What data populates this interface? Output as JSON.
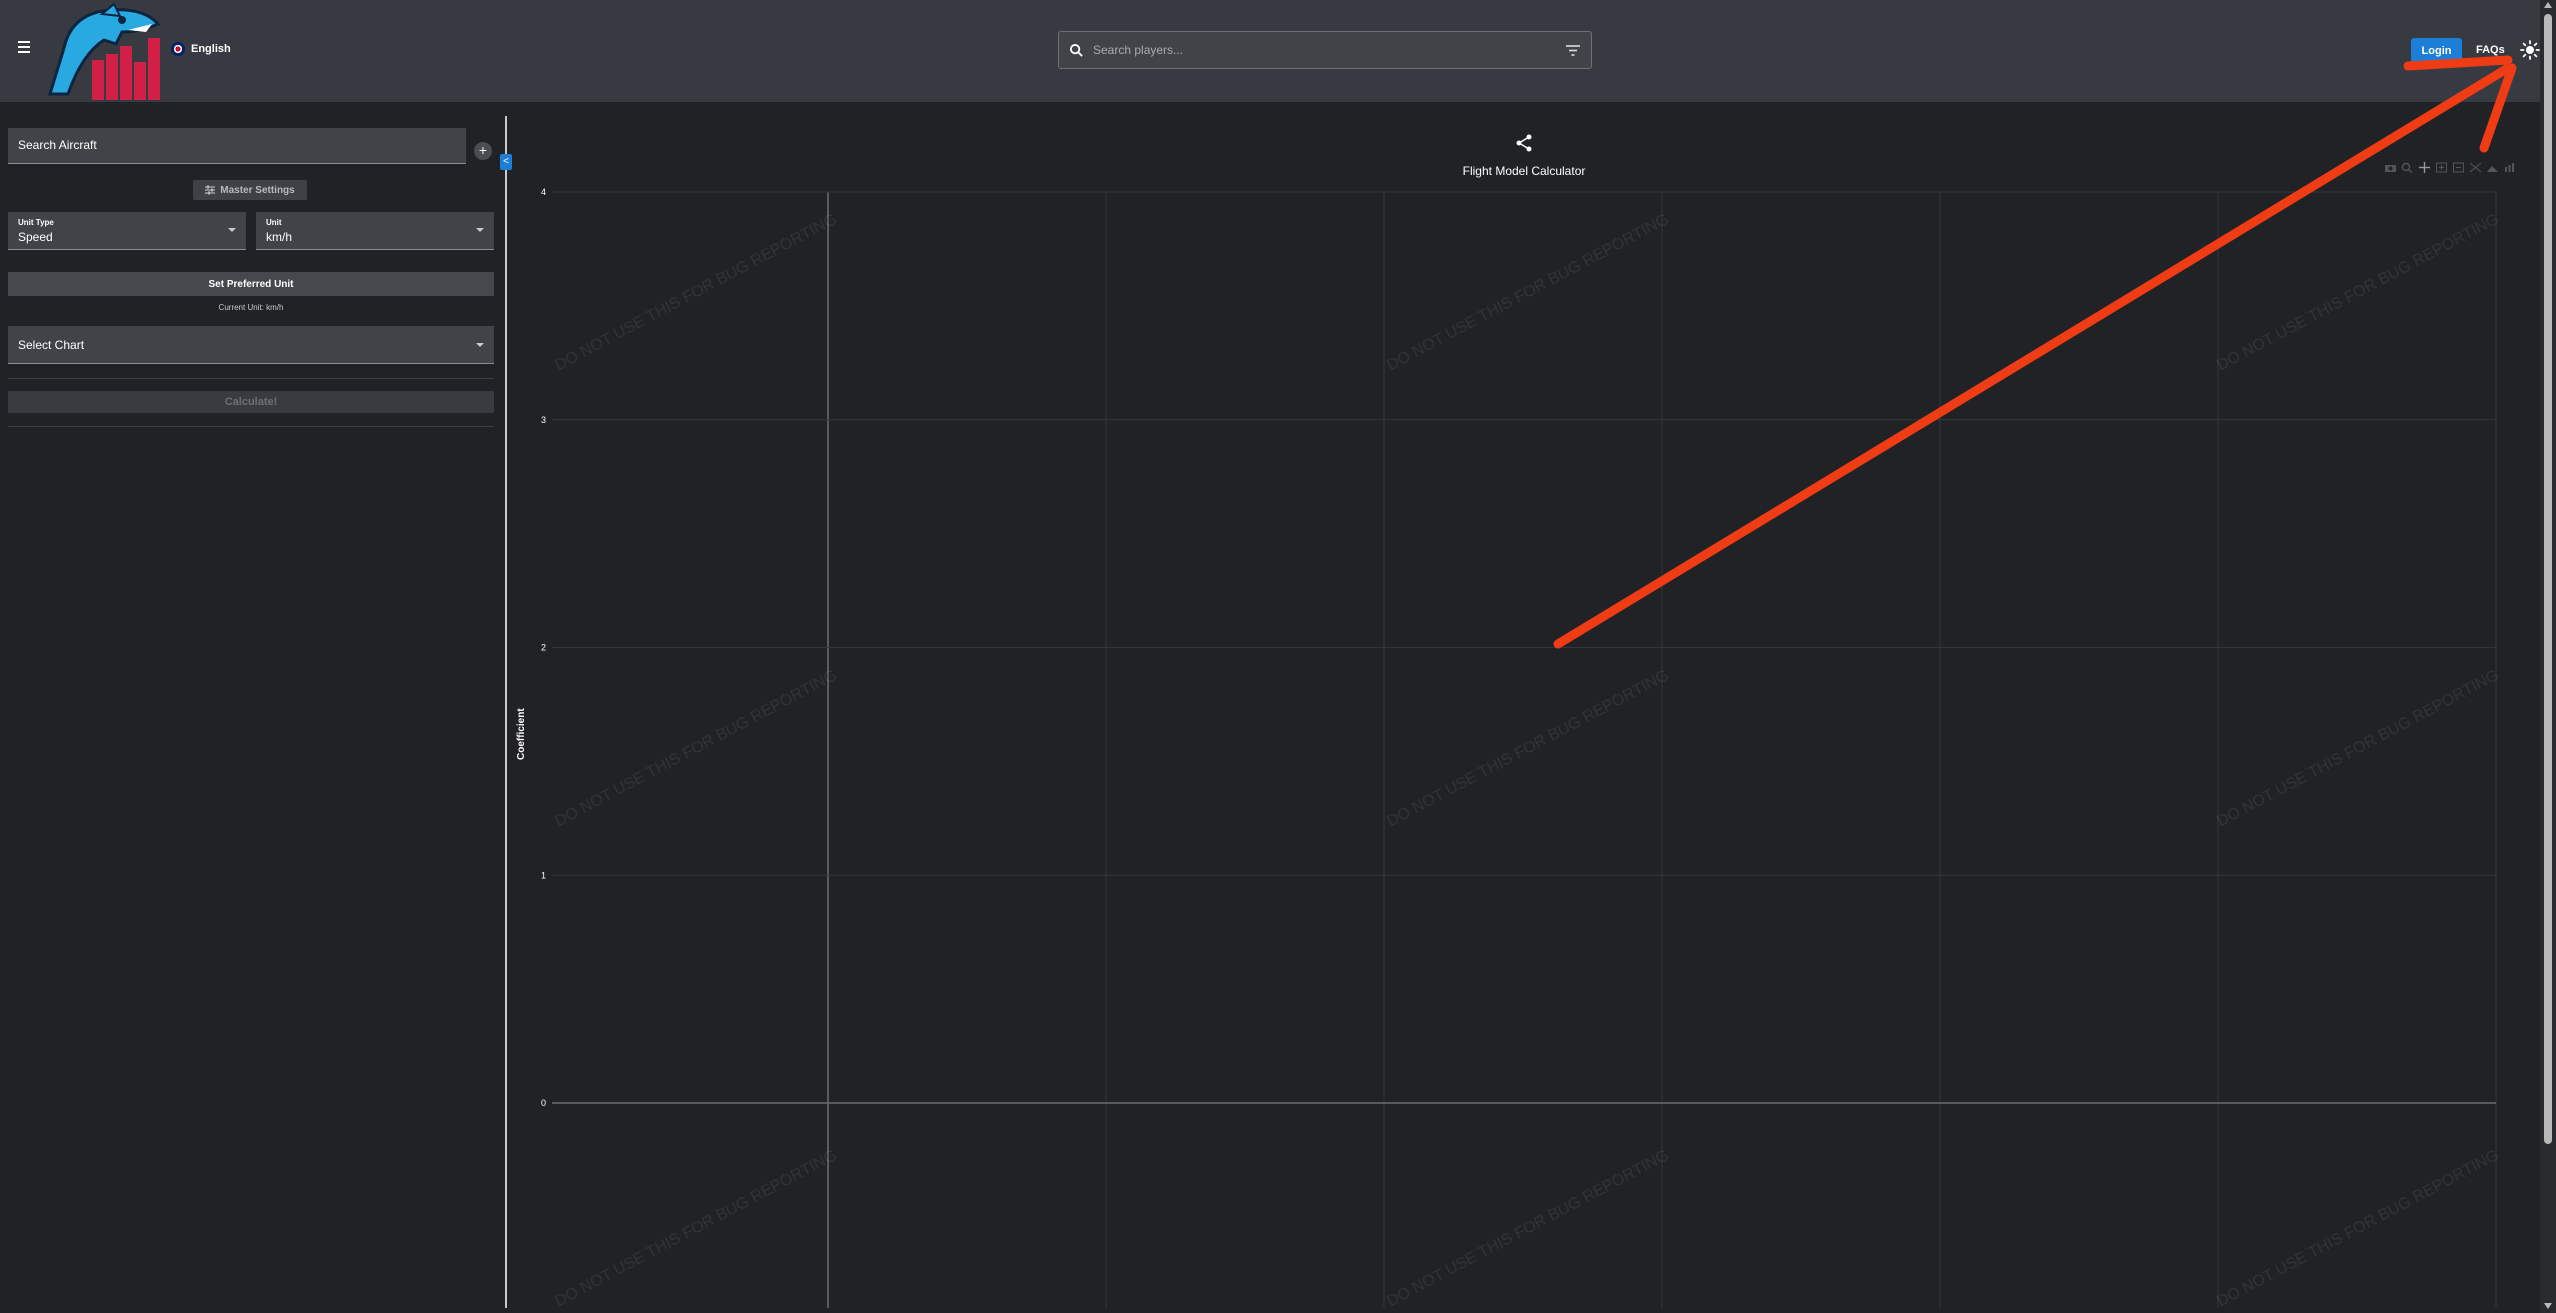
{
  "header": {
    "language": "English",
    "search_placeholder": "Search players...",
    "login_label": "Login",
    "faqs_label": "FAQs",
    "icons": [
      "menu-icon",
      "shark-logo",
      "uk-flag-icon",
      "search-icon",
      "filter-icon",
      "sun-icon"
    ]
  },
  "sidebar": {
    "search_aircraft": "Search Aircraft",
    "add_label": "+",
    "master_settings": "Master Settings",
    "unit_type": {
      "label": "Unit Type",
      "value": "Speed"
    },
    "unit": {
      "label": "Unit",
      "value": "km/h"
    },
    "set_preferred_unit": "Set Preferred Unit",
    "current_unit": "Current Unit: km/h",
    "select_chart": "Select Chart",
    "calculate": "Calculate!",
    "collapse_label": "<"
  },
  "chart_data": {
    "type": "line",
    "title": "Flight Model Calculator",
    "ylabel": "Coefficient",
    "xlabel": "",
    "series": [],
    "y_ticks": [
      "4",
      "3",
      "2",
      "1",
      "0"
    ],
    "ylim": [
      -0.9,
      4
    ],
    "grid": true,
    "watermark": "DO NOT USE THIS FOR BUG REPORTING"
  },
  "annotation": {
    "color": "#f03c14",
    "description": "red arrow pointing to theme toggle"
  },
  "colors": {
    "accent": "#1c7ed6",
    "header_bg": "#373a40",
    "page_bg": "#212226"
  }
}
